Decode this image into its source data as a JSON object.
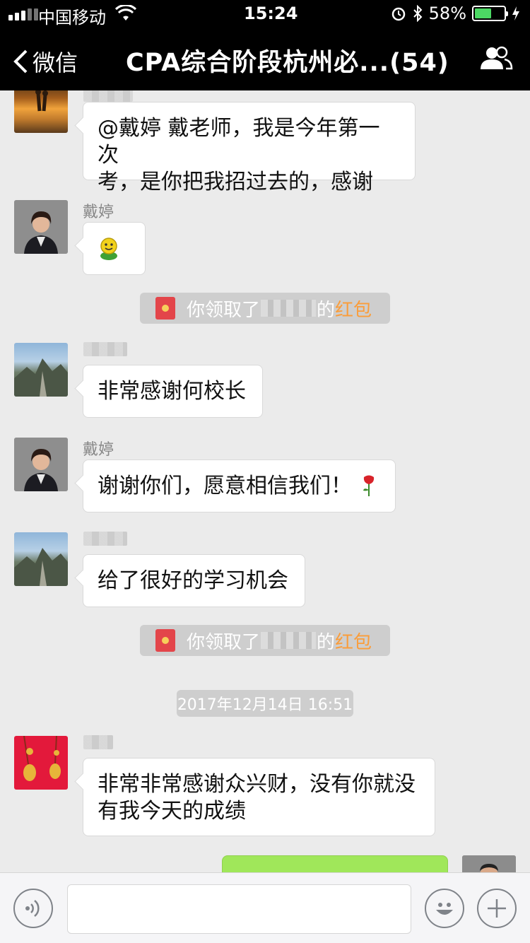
{
  "status_bar": {
    "carrier": "中国移动",
    "time": "15:24",
    "battery_percent": "58%",
    "battery_level": 0.58
  },
  "nav": {
    "back_label": "微信",
    "title": "CPA综合阶段杭州必...(54)"
  },
  "messages": [
    {
      "sender": "",
      "text_lines": [
        "@戴婷 戴老师，我是今年第一次",
        "考，是你把我招过去的，感谢"
      ]
    },
    {
      "sender": "戴婷",
      "text_lines": []
    },
    {
      "sender": "",
      "text_lines": [
        "非常感谢何校长"
      ]
    },
    {
      "sender": "戴婷",
      "text_lines": [
        "谢谢你们，愿意相信我们！"
      ]
    },
    {
      "sender": "",
      "text_lines": [
        "给了很好的学习机会"
      ]
    },
    {
      "sender": "",
      "text_lines": [
        "非常非常感谢众兴财，没有你就没",
        "有我今天的成绩"
      ]
    }
  ],
  "system_notices": [
    {
      "prefix": "你领取了",
      "suffix": "的",
      "link": "红包"
    },
    {
      "prefix": "你领取了",
      "suffix": "的",
      "link": "红包"
    }
  ],
  "timestamp": "2017年12月14日 16:51",
  "colors": {
    "nav_bg": "#000000",
    "chat_bg": "#ebebeb",
    "hongbao_link": "#fa9d3b",
    "my_bubble": "#a0e75a"
  },
  "icons": [
    "signal-icon",
    "wifi-icon",
    "alarm-icon",
    "bluetooth-icon",
    "battery-icon",
    "charging-icon",
    "back-chevron-icon",
    "group-members-icon",
    "voice-icon",
    "emoji-icon",
    "plus-icon",
    "red-envelope-icon",
    "smile-sticker-icon",
    "rose-icon"
  ]
}
